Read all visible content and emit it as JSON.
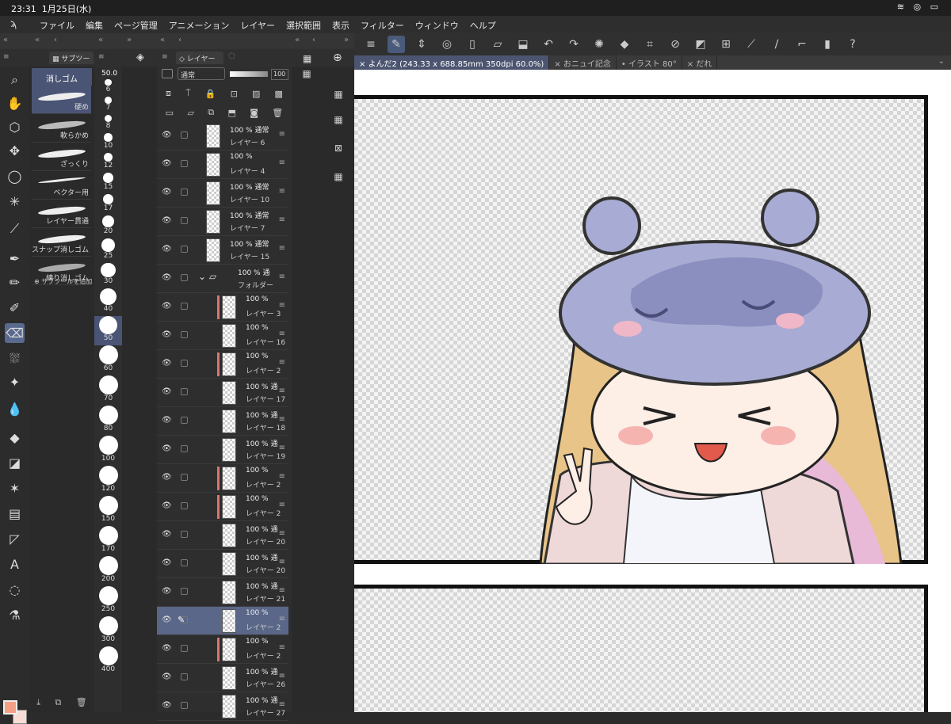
{
  "status": {
    "time": "23:31",
    "date": "1月25日(水)",
    "icons": "≋ ◎ ▭"
  },
  "app": {
    "logo": "ϡ"
  },
  "menu": [
    "ファイル",
    "編集",
    "ページ管理",
    "アニメーション",
    "レイヤー",
    "選択範囲",
    "表示",
    "フィルター",
    "ウィンドウ",
    "ヘルプ"
  ],
  "panels": {
    "subtool_tab": "サブツー",
    "layer_tab": "レイヤー"
  },
  "subtool": {
    "header": "消しゴム",
    "brushes": [
      {
        "label": "硬め",
        "active": true
      },
      {
        "label": "軟らかめ"
      },
      {
        "label": "ざっくり"
      },
      {
        "label": "ベクター用"
      },
      {
        "label": "レイヤー貫通"
      },
      {
        "label": "スナップ消しゴム"
      },
      {
        "label": "練り消しゴム"
      }
    ],
    "add_label": "サブツールを追加"
  },
  "brush_size": {
    "value": "50.0",
    "sizes": [
      "6",
      "7",
      "8",
      "10",
      "12",
      "15",
      "17",
      "20",
      "25",
      "30",
      "40",
      "50",
      "60",
      "70",
      "80",
      "100",
      "120",
      "150",
      "170",
      "200",
      "250",
      "300",
      "400"
    ],
    "selected": "50"
  },
  "layer_panel": {
    "blend_mode": "通常",
    "opacity": "100",
    "layers": [
      {
        "opacity": "100 %",
        "blend": "通常",
        "name": "レイヤー 6",
        "indent": 0
      },
      {
        "opacity": "100 %",
        "blend": "",
        "name": "レイヤー 4",
        "indent": 0
      },
      {
        "opacity": "100 %",
        "blend": "通常",
        "name": "レイヤー 10",
        "indent": 0
      },
      {
        "opacity": "100 %",
        "blend": "通常",
        "name": "レイヤー 7",
        "indent": 0
      },
      {
        "opacity": "100 %",
        "blend": "通常",
        "name": "レイヤー 15",
        "indent": 0
      },
      {
        "opacity": "100 %",
        "blend": "通",
        "name": "フォルダー",
        "indent": 1,
        "folder": true
      },
      {
        "opacity": "100 %",
        "blend": "",
        "name": "レイヤー 3",
        "indent": 2,
        "clip": true
      },
      {
        "opacity": "100 %",
        "blend": "",
        "name": "レイヤー 16",
        "indent": 2
      },
      {
        "opacity": "100 %",
        "blend": "",
        "name": "レイヤー 2",
        "indent": 2,
        "clip": true
      },
      {
        "opacity": "100 %",
        "blend": "通",
        "name": "レイヤー 17",
        "indent": 2
      },
      {
        "opacity": "100 %",
        "blend": "通",
        "name": "レイヤー 18",
        "indent": 2
      },
      {
        "opacity": "100 %",
        "blend": "通",
        "name": "レイヤー 19",
        "indent": 2
      },
      {
        "opacity": "100 %",
        "blend": "",
        "name": "レイヤー 2",
        "indent": 2,
        "clip": true
      },
      {
        "opacity": "100 %",
        "blend": "",
        "name": "レイヤー 2",
        "indent": 2,
        "clip": true
      },
      {
        "opacity": "100 %",
        "blend": "通",
        "name": "レイヤー 20",
        "indent": 2
      },
      {
        "opacity": "100 %",
        "blend": "通",
        "name": "レイヤー 20",
        "indent": 2
      },
      {
        "opacity": "100 %",
        "blend": "通",
        "name": "レイヤー 21",
        "indent": 2
      },
      {
        "opacity": "100 %",
        "blend": "",
        "name": "レイヤー 2",
        "indent": 2,
        "active": true
      },
      {
        "opacity": "100 %",
        "blend": "",
        "name": "レイヤー 2",
        "indent": 2,
        "clip": true
      },
      {
        "opacity": "100 %",
        "blend": "通",
        "name": "レイヤー 26",
        "indent": 2
      },
      {
        "opacity": "100 %",
        "blend": "通",
        "name": "レイヤー 27",
        "indent": 2
      }
    ]
  },
  "doc_tabs": [
    {
      "label": "よんだ2 (243.33 x 688.85mm 350dpi 60.0%)",
      "active": true
    },
    {
      "label": "おニュイ記念"
    },
    {
      "label": "イラスト 80°"
    },
    {
      "label": "だれ"
    }
  ],
  "colors": {
    "main": "#f4a085",
    "sub": "#f7dcd3",
    "accent": "#4a5575"
  }
}
